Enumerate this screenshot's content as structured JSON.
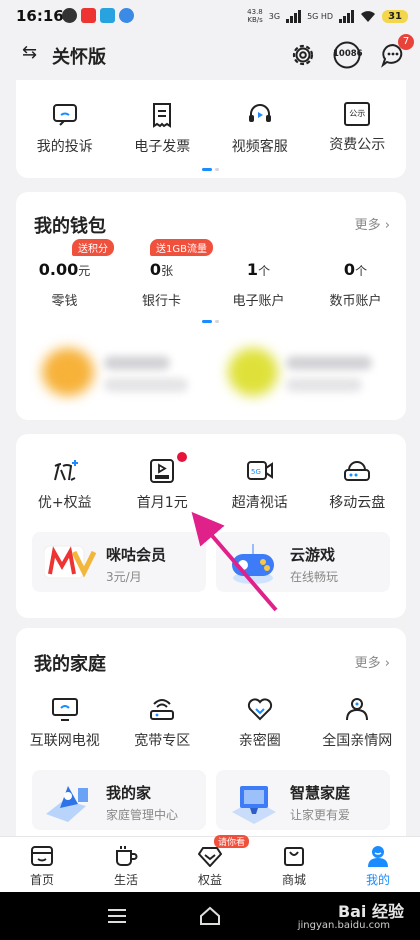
{
  "status_bar": {
    "time": "16:16",
    "speed_top": "43.8",
    "speed_unit": "KB/s",
    "net1": "3G",
    "net2": "5G HD",
    "battery": "31"
  },
  "header": {
    "title": "关怀版",
    "phone_label": "10086",
    "message_badge": "7"
  },
  "services": [
    {
      "label": "我的投诉",
      "icon": "complaint-icon"
    },
    {
      "label": "电子发票",
      "icon": "invoice-icon"
    },
    {
      "label": "视频客服",
      "icon": "headset-icon"
    },
    {
      "label": "资费公示",
      "icon": "tariff-notice-icon",
      "icon_text": "公示"
    }
  ],
  "wallet": {
    "title": "我的钱包",
    "more": "更多",
    "items": [
      {
        "value": "0.00",
        "unit": "元",
        "label": "零钱",
        "tag": "送积分"
      },
      {
        "value": "0",
        "unit": "张",
        "label": "银行卡",
        "tag": "送1GB流量"
      },
      {
        "value": "1",
        "unit": "个",
        "label": "电子账户",
        "tag": ""
      },
      {
        "value": "0",
        "unit": "个",
        "label": "数币账户",
        "tag": ""
      }
    ]
  },
  "benefits": {
    "items": [
      {
        "label": "优+权益",
        "icon": "youplus-icon"
      },
      {
        "label": "首月1元",
        "icon": "vip-video-icon"
      },
      {
        "label": "超清视话",
        "icon": "5g-video-call-icon"
      },
      {
        "label": "移动云盘",
        "icon": "cloud-drive-icon"
      }
    ],
    "promos": [
      {
        "title": "咪咕会员",
        "subtitle": "3元/月",
        "icon": "migu-icon"
      },
      {
        "title": "云游戏",
        "subtitle": "在线畅玩",
        "icon": "gamepad-icon"
      }
    ]
  },
  "family": {
    "title": "我的家庭",
    "more": "更多",
    "items": [
      {
        "label": "互联网电视",
        "icon": "tv-icon"
      },
      {
        "label": "宽带专区",
        "icon": "router-icon"
      },
      {
        "label": "亲密圈",
        "icon": "heart-circle-icon"
      },
      {
        "label": "全国亲情网",
        "icon": "family-network-icon"
      }
    ],
    "promos": [
      {
        "title": "我的家",
        "subtitle": "家庭管理中心",
        "icon": "home-map-icon"
      },
      {
        "title": "智慧家庭",
        "subtitle": "让家更有爱",
        "icon": "smart-home-icon"
      }
    ]
  },
  "bottom_nav": [
    {
      "label": "首页",
      "icon": "home-icon"
    },
    {
      "label": "生活",
      "icon": "cup-icon"
    },
    {
      "label": "权益",
      "icon": "diamond-icon",
      "badge": "请你看"
    },
    {
      "label": "商城",
      "icon": "shopping-bag-icon"
    },
    {
      "label": "我的",
      "icon": "user-icon",
      "active": true
    }
  ],
  "watermark": {
    "main": "Bai 经验",
    "sub": "jingyan.baidu.com"
  },
  "colors": {
    "accent": "#1a8cff",
    "red": "#e8433a",
    "tag": "#f0513d",
    "annotation_arrow": "#e0218a"
  }
}
